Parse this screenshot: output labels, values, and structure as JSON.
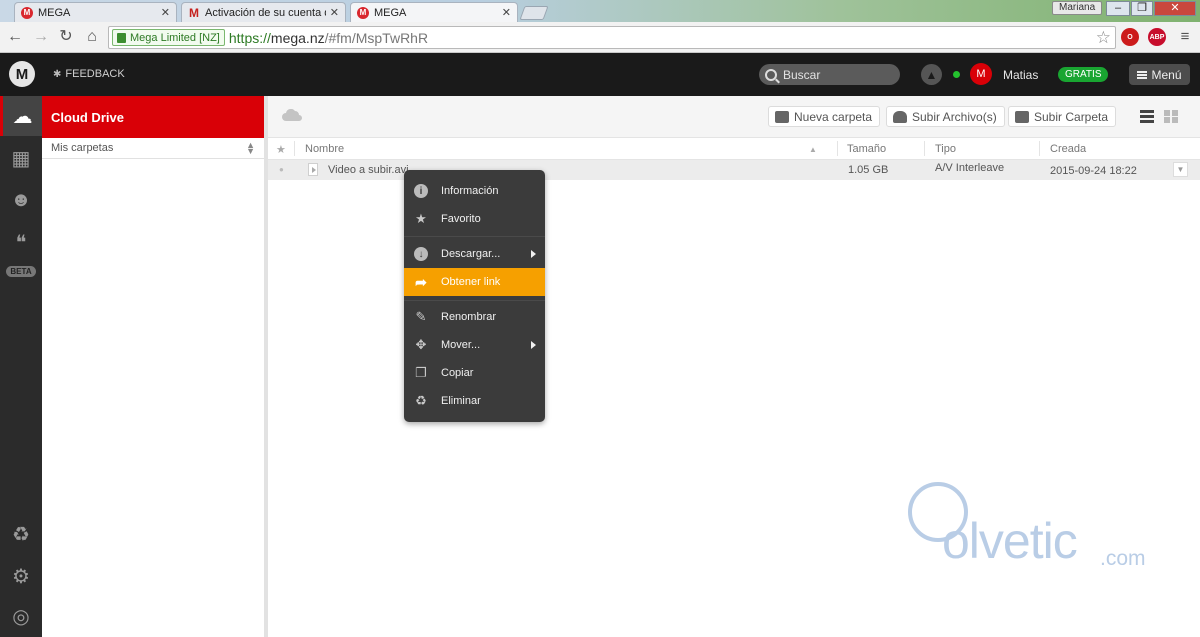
{
  "browser": {
    "tabs": [
      {
        "label": "MEGA",
        "favicon": "mega-icon"
      },
      {
        "label": "Activación de su cuenta d",
        "favicon": "gmail-icon"
      },
      {
        "label": "MEGA",
        "favicon": "mega-icon",
        "active": true
      }
    ],
    "profile_name": "Mariana",
    "window_buttons": {
      "minimize": "–",
      "restore": "❐",
      "close": "✕"
    },
    "security_badge": "Mega Limited [NZ]",
    "url_scheme": "https://",
    "url_host": "mega.nz",
    "url_path": "/#fm/MspTwRhR",
    "extensions": [
      "opera-icon",
      "adblock-plus-icon"
    ],
    "extension_labels": {
      "adblock": "ABP"
    }
  },
  "topbar": {
    "logo": "M",
    "feedback_label": "FEEDBACK",
    "search_placeholder": "Buscar",
    "avatar_initial": "M",
    "username": "Matias",
    "plan_badge": "GRATIS",
    "menu_label": "Menú"
  },
  "sidebar": {
    "beta_label": "BETA"
  },
  "tree": {
    "header": "Cloud Drive",
    "sort_label": "Mis carpetas"
  },
  "toolbar": {
    "new_folder": "Nueva carpeta",
    "upload_files": "Subir Archivo(s)",
    "upload_folder": "Subir Carpeta"
  },
  "table": {
    "columns": {
      "name": "Nombre",
      "size": "Tamaño",
      "type": "Tipo",
      "created": "Creada"
    },
    "rows": [
      {
        "name": "Video a subir.avi",
        "size": "1.05 GB",
        "type": "A/V Interleave",
        "created": "2015-09-24 18:22"
      }
    ]
  },
  "context_menu": {
    "items": [
      {
        "label": "Información",
        "icon": "info-icon"
      },
      {
        "label": "Favorito",
        "icon": "star-icon"
      },
      {
        "label": "Descargar...",
        "icon": "download-icon",
        "submenu": true
      },
      {
        "label": "Obtener link",
        "icon": "link-arrow-icon",
        "highlighted": true
      },
      {
        "label": "Renombrar",
        "icon": "pencil-icon"
      },
      {
        "label": "Mover...",
        "icon": "move-icon",
        "submenu": true
      },
      {
        "label": "Copiar",
        "icon": "copy-icon"
      },
      {
        "label": "Eliminar",
        "icon": "recycle-icon"
      }
    ]
  },
  "watermark": {
    "text": "olvetic",
    "domain": ".com"
  },
  "colors": {
    "mega_red": "#d90007",
    "highlight": "#f6a000",
    "plan_green": "#19a531"
  }
}
